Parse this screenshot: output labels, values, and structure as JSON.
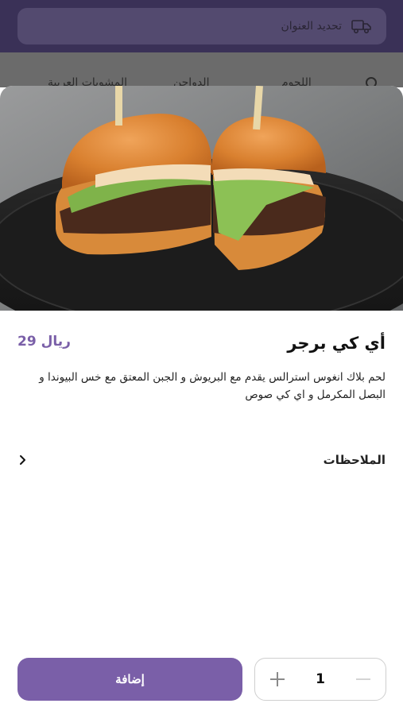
{
  "header": {
    "address_label": "تحديد العنوان"
  },
  "nav": {
    "tabs": [
      "المشويات العربية",
      "الدواجن",
      "اللحوم"
    ]
  },
  "product": {
    "name": "أي كي برجر",
    "price": "29 ريال",
    "description": "لحم بلاك انغوس استرالس يقدم مع البريوش و الجبن المعتق مع خس البيوندا و البصل المكرمل و اي كي صوص"
  },
  "notes": {
    "label": "الملاحظات"
  },
  "cart": {
    "quantity": "1",
    "add_label": "إضافة"
  },
  "colors": {
    "accent": "#7a5fa8",
    "header_dim": "#3a3157"
  },
  "icons": {
    "address": "truck-icon",
    "search": "search-icon",
    "notes": "chevron-right-icon",
    "increment": "plus-icon",
    "decrement": "minus-icon"
  }
}
